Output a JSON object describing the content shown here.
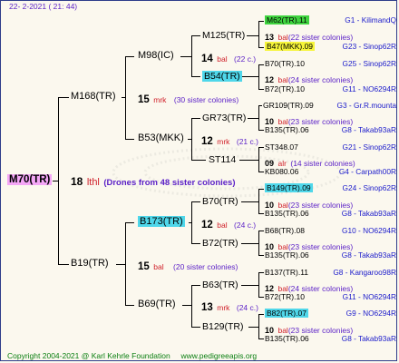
{
  "header": {
    "date": "22-  2-2021  ( 21: 44)"
  },
  "footer": {
    "copyright": "Copyright 2004-2021 @ Karl Kehrle Foundation",
    "site": "www.pedigreeapis.org"
  },
  "root": {
    "name": "M70(TR)",
    "num": "18",
    "race": "lthl",
    "note": "(Drones from 48 sister colonies)"
  },
  "gen1": [
    {
      "name": "M168(TR)",
      "num": "15",
      "race": "mrk",
      "note": "(30 sister colonies)"
    },
    {
      "name": "B19(TR)",
      "num": "15",
      "race": "bal",
      "note": "(20 sister colonies)"
    }
  ],
  "gen2": [
    {
      "name": "M98(IC)",
      "num": "14",
      "race": "bal",
      "note": "(22 c.)"
    },
    {
      "name": "B53(MKK)",
      "num": "12",
      "race": "mrk",
      "note": "(21 c.)"
    },
    {
      "name": "B173(TR)",
      "num": "12",
      "race": "bal",
      "note": "(24 c.)"
    },
    {
      "name": "B69(TR)",
      "num": "13",
      "race": "mrk",
      "note": "(24 c.)"
    }
  ],
  "gen3": [
    {
      "name": "M125(TR)"
    },
    {
      "name": "B54(TR)"
    },
    {
      "name": "GR73(TR)"
    },
    {
      "name": "ST114"
    },
    {
      "name": "B70(TR)"
    },
    {
      "name": "B72(TR)"
    },
    {
      "name": "B63(TR)"
    },
    {
      "name": "B129(TR)"
    }
  ],
  "gen4": [
    {
      "name": "M62(TR).11",
      "right": "G1 - KilimandQ"
    },
    {
      "name": "",
      "num": "13",
      "race": "bal",
      "note": "(22 sister colonies)"
    },
    {
      "name": "B47(MKK).09",
      "right": "G23 - Sinop62R"
    },
    {
      "name": "B70(TR).10",
      "right": "G25 - Sinop62R"
    },
    {
      "name": "",
      "num": "12",
      "race": "bal",
      "note": "(24 sister colonies)"
    },
    {
      "name": "B72(TR).10",
      "right": "G11 - NO6294R"
    },
    {
      "name": "GR109(TR).09",
      "right": "G3 - Gr.R.mounta"
    },
    {
      "name": "",
      "num": "10",
      "race": "bal",
      "note": "(23 sister colonies)"
    },
    {
      "name": "B135(TR).06",
      "right": "G8 - Takab93aR"
    },
    {
      "name": "ST348.07",
      "right": "G21 - Sinop62R"
    },
    {
      "name": "",
      "num": "09",
      "race": "alr",
      "note": "(14 sister colonies)"
    },
    {
      "name": "KB080.06",
      "right": "G4 - Carpath00R"
    },
    {
      "name": "B149(TR).09",
      "right": "G24 - Sinop62R"
    },
    {
      "name": "",
      "num": "10",
      "race": "bal",
      "note": "(23 sister colonies)"
    },
    {
      "name": "B135(TR).06",
      "right": "G8 - Takab93aR"
    },
    {
      "name": "B68(TR).08",
      "right": "G10 - NO6294R"
    },
    {
      "name": "",
      "num": "10",
      "race": "bal",
      "note": "(23 sister colonies)"
    },
    {
      "name": "B135(TR).06",
      "right": "G8 - Takab93aR"
    },
    {
      "name": "B137(TR).11",
      "right": "G8 - Kangaroo98R"
    },
    {
      "name": "",
      "num": "12",
      "race": "bal",
      "note": "(24 sister colonies)"
    },
    {
      "name": "B72(TR).10",
      "right": "G11 - NO6294R"
    },
    {
      "name": "B82(TR).07",
      "right": "G9 - NO6294R"
    },
    {
      "name": "",
      "num": "10",
      "race": "bal",
      "note": "(23 sister colonies)"
    },
    {
      "name": "B135(TR).06",
      "right": "G8 - Takab93aR"
    }
  ]
}
